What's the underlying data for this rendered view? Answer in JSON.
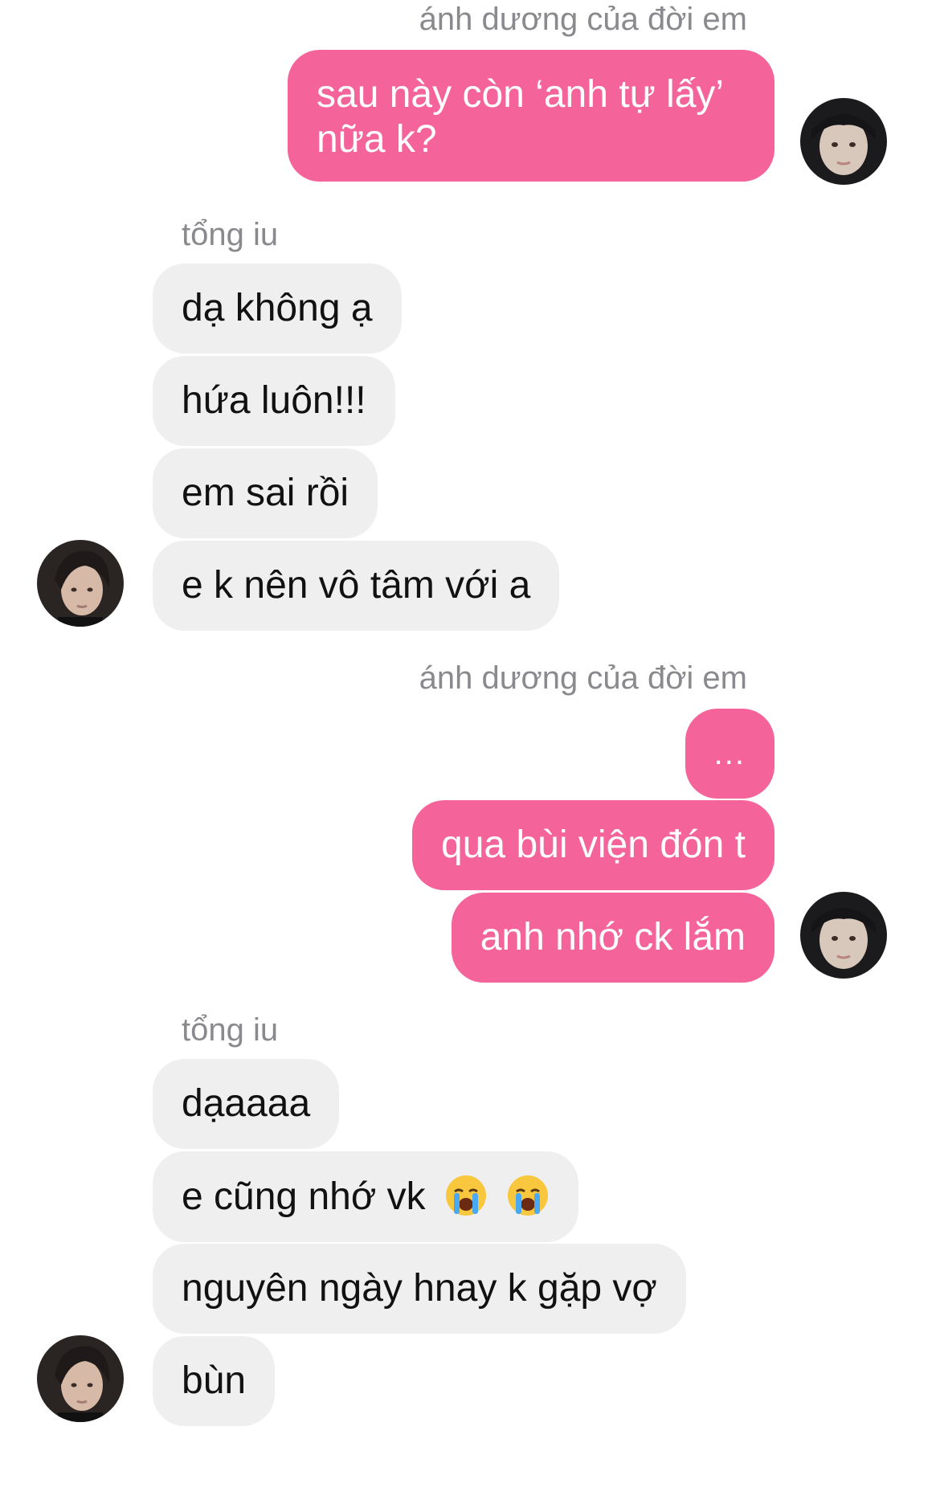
{
  "chat": {
    "sender_me": "ánh dương của đời em",
    "sender_them": "tổng iu",
    "colors": {
      "outgoing_bubble": "#f4639a",
      "incoming_bubble": "#efeff0",
      "sender_name": "#8a8a8e"
    },
    "group1": {
      "sender": "ánh dương của đời em",
      "messages": [
        "sau này còn ‘anh tự lấy’ nữa k?"
      ]
    },
    "group2": {
      "sender": "tổng iu",
      "messages": [
        "dạ không ạ",
        "hứa luôn!!!",
        "em sai rồi",
        "e k nên vô tâm với a"
      ]
    },
    "group3": {
      "sender": "ánh dương của đời em",
      "messages": [
        "...",
        "qua bùi viện đón t",
        "anh nhớ ck lắm"
      ]
    },
    "group4": {
      "sender": "tổng iu",
      "messages": [
        "dạaaaa",
        "e cũng nhớ vk",
        "nguyên ngày hnay k gặp vợ",
        "bùn"
      ],
      "emoji": [
        "loudly-crying-face-icon",
        "loudly-crying-face-icon"
      ]
    }
  }
}
